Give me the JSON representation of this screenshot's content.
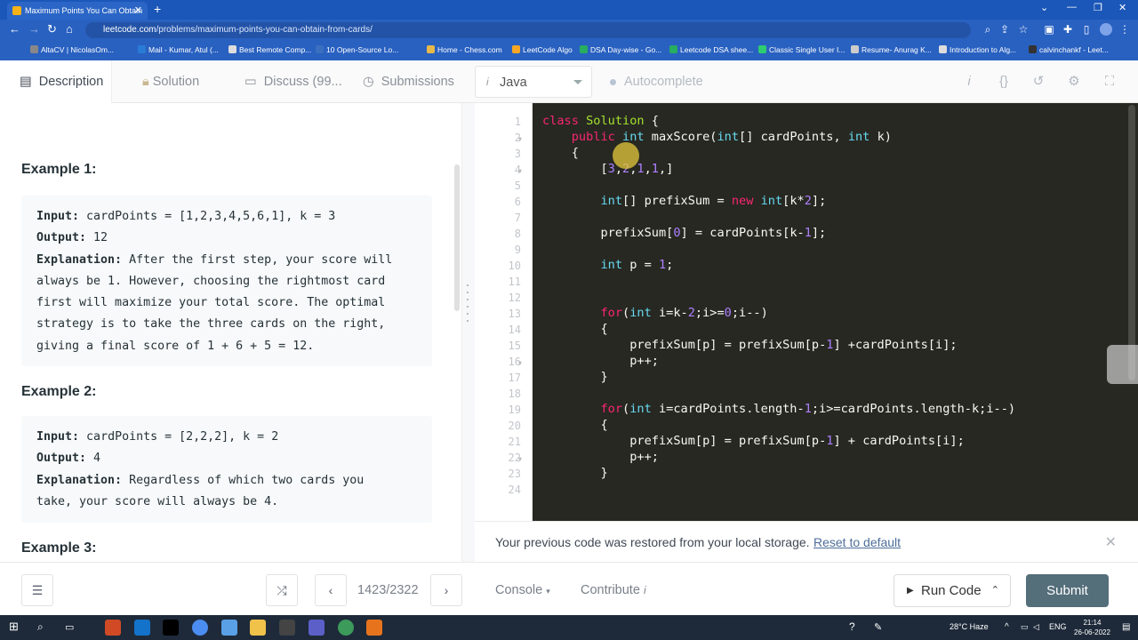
{
  "browser": {
    "tab_title": "Maximum Points You Can Obtain",
    "url_host": "leetcode.com",
    "url_path": "/problems/maximum-points-you-can-obtain-from-cards/",
    "bookmarks": [
      "AltaCV | NicolasOm...",
      "Mail - Kumar, Atul (...",
      "Best Remote Comp...",
      "10 Open-Source Lo...",
      "Home - Chess.com",
      "LeetCode Algo",
      "DSA Day-wise - Go...",
      "Leetcode DSA shee...",
      "Classic Single User I...",
      "Resume- Anurag K...",
      "Introduction to Alg...",
      "calvinchankf - Leet..."
    ]
  },
  "tabs": {
    "description": "Description",
    "solution": "Solution",
    "discuss": "Discuss (99...",
    "submissions": "Submissions"
  },
  "editor_header": {
    "language": "Java",
    "autocomplete": "Autocomplete"
  },
  "description": {
    "example1_title": "Example 1:",
    "example1": {
      "input_label": "Input:",
      "input_value": " cardPoints = [1,2,3,4,5,6,1], k = 3",
      "output_label": "Output:",
      "output_value": " 12",
      "explanation_label": "Explanation:",
      "explanation_lines": [
        " After the first step, your score will",
        "always be 1. However, choosing the rightmost card",
        "first will maximize your total score. The optimal",
        "strategy is to take the three cards on the right,",
        "giving a final score of 1 + 6 + 5 = 12."
      ]
    },
    "example2_title": "Example 2:",
    "example2": {
      "input_label": "Input:",
      "input_value": " cardPoints = [2,2,2], k = 2",
      "output_label": "Output:",
      "output_value": " 4",
      "explanation_label": "Explanation:",
      "explanation_lines": [
        " Regardless of which two cards you",
        "take, your score will always be 4."
      ]
    },
    "example3_title": "Example 3:"
  },
  "editor": {
    "line_numbers": [
      "1",
      "2",
      "3",
      "4",
      "5",
      "6",
      "7",
      "8",
      "9",
      "10",
      "11",
      "12",
      "13",
      "14",
      "15",
      "16",
      "17",
      "18",
      "19",
      "20",
      "21",
      "22",
      "23",
      "24"
    ],
    "lines": [
      "class Solution {",
      "    public int maxScore(int[] cardPoints, int k)",
      "    {",
      "        [3,2,1,1,]",
      "",
      "        int[] prefixSum = new int[k*2];",
      "",
      "        prefixSum[0] = cardPoints[k-1];",
      "",
      "        int p = 1;",
      "",
      "",
      "        for(int i=k-2;i>=0;i--)",
      "        {",
      "            prefixSum[p] = prefixSum[p-1] +cardPoints[i];",
      "            p++;",
      "        }",
      "",
      "        for(int i=cardPoints.length-1;i>=cardPoints.length-k;i--)",
      "        {",
      "            prefixSum[p] = prefixSum[p-1] + cardPoints[i];",
      "            p++;",
      "        }",
      ""
    ]
  },
  "notice": {
    "text": "Your previous code was restored from your local storage.",
    "link": "Reset to default"
  },
  "bottom": {
    "pager": "1423/2322",
    "console": "Console",
    "contribute": "Contribute",
    "run": "Run Code",
    "submit": "Submit"
  },
  "taskbar": {
    "weather": "28°C  Haze",
    "lang": "ENG",
    "time": "21:14",
    "date": "26-06-2022"
  }
}
